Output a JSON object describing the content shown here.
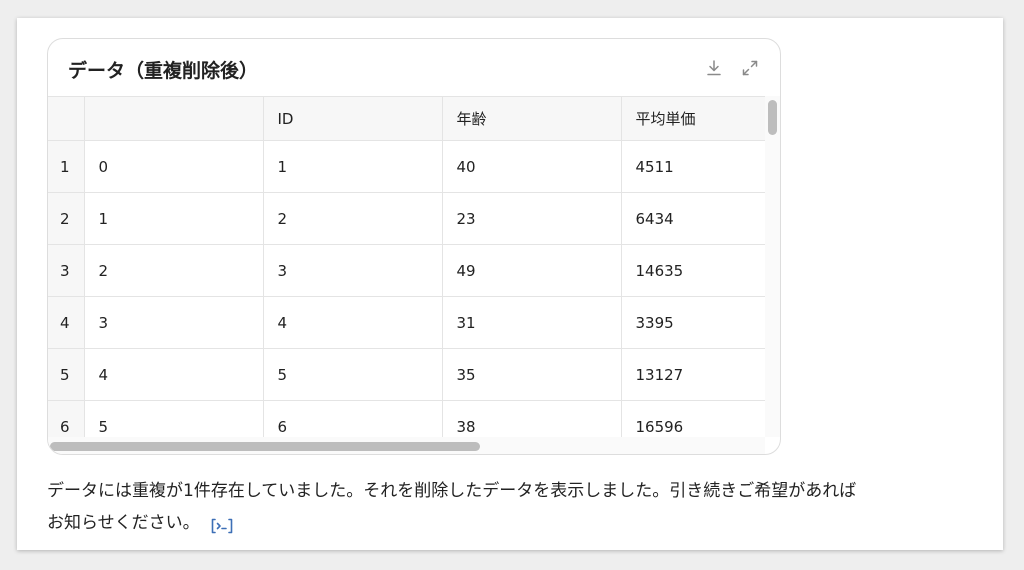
{
  "card": {
    "title": "データ（重複削除後）",
    "icons": [
      "download-icon",
      "expand-icon"
    ]
  },
  "table": {
    "columns": [
      "",
      "",
      "ID",
      "年齢",
      "平均単価"
    ],
    "rows": [
      [
        "1",
        "0",
        "1",
        "40",
        "4511"
      ],
      [
        "2",
        "1",
        "2",
        "23",
        "6434"
      ],
      [
        "3",
        "2",
        "3",
        "49",
        "14635"
      ],
      [
        "4",
        "3",
        "4",
        "31",
        "3395"
      ],
      [
        "5",
        "4",
        "5",
        "35",
        "13127"
      ],
      [
        "6",
        "5",
        "6",
        "38",
        "16596"
      ]
    ]
  },
  "message": {
    "line1": "データには重複が1件存在していました。それを削除したデータを表示しました。引き続きご希望があれば",
    "line2": "お知らせください。",
    "icon": "code-view-icon"
  },
  "colors": {
    "accent_icon": "#3d6fb6",
    "header_bg": "#f7f7f7",
    "border": "#e4e4e4"
  }
}
